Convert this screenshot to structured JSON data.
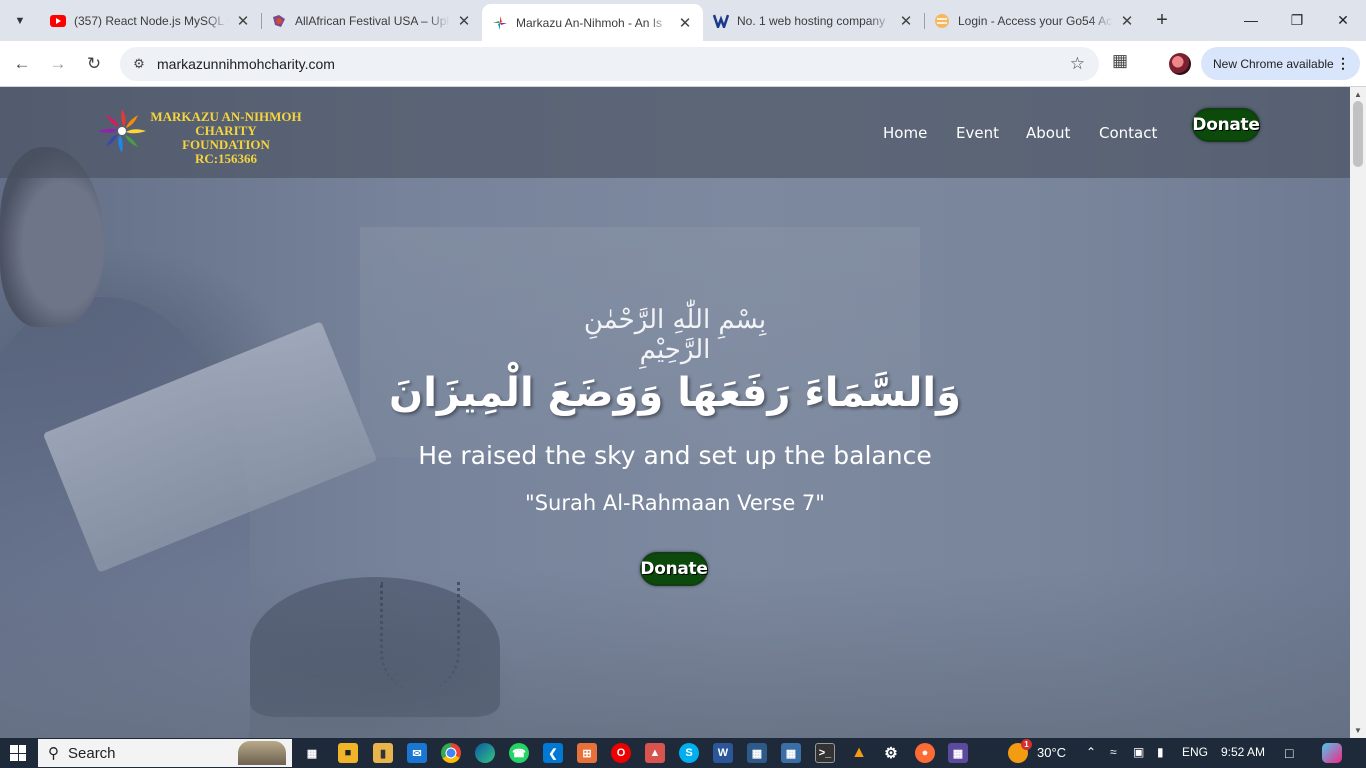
{
  "browser": {
    "tabs": [
      {
        "title": "(357) React Node.js MySQL C",
        "favicon": "youtube-icon",
        "active": false
      },
      {
        "title": "AllAfrican Festival USA – Upl",
        "favicon": "festival-icon",
        "active": false
      },
      {
        "title": "Markazu An-Nihmoh - An Is",
        "favicon": "markazu-icon",
        "active": true
      },
      {
        "title": "No. 1 web hosting company",
        "favicon": "hosting-icon",
        "active": false
      },
      {
        "title": "Login - Access your Go54 Ac",
        "favicon": "go54-icon",
        "active": false
      }
    ],
    "url": "markazunnihmohcharity.com",
    "update_chip": "New Chrome available"
  },
  "site": {
    "brand": {
      "line1": "MARKAZU AN-NIHMOH",
      "line2": "CHARITY FOUNDATION",
      "line3": "RC:156366"
    },
    "nav": {
      "home": "Home",
      "event": "Event",
      "about": "About",
      "contact": "Contact",
      "donate": "Donate"
    },
    "hero": {
      "bismillah": "بِسْمِ اللّٰهِ الرَّحْمٰنِ الرَّحِيْمِ",
      "arabic_verse": "وَالسَّمَاءَ رَفَعَهَا وَوَضَعَ الْمِيزَانَ",
      "translation": "He raised the sky and set up the balance",
      "citation": "\"Surah Al-Rahmaan Verse 7\"",
      "donate": "Donate"
    }
  },
  "taskbar": {
    "search_placeholder": "Search",
    "weather": "30°C",
    "language": "ENG",
    "time": "9:52 AM",
    "weather_badge": "1"
  },
  "colors": {
    "brand_text": "#f5d43c",
    "donate_bg": "#0b4a0b",
    "nav_overlay": "#485060"
  }
}
